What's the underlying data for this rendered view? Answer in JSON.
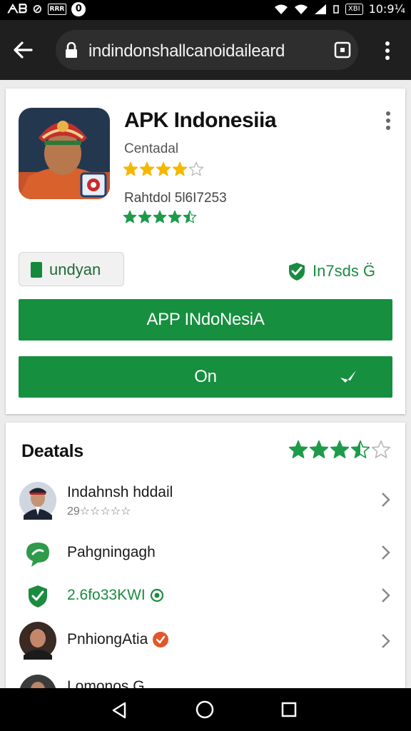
{
  "status_bar": {
    "left_text": "ᗅᗷ",
    "box_label": "RRR",
    "ring_label": "0",
    "battery_label": "XBI",
    "time": "10:9¼"
  },
  "browser": {
    "url": "indindonshallcanoidaileard",
    "icons": [
      "back-arrow-icon",
      "lock-icon",
      "tab-switcher-icon",
      "more-vertical-icon"
    ]
  },
  "app": {
    "title": "APK Indonesiia",
    "publisher": "Centadal",
    "rating_value": 4,
    "rating_line": "Rahtdol 5l6I7253",
    "rating2_value": 4.5,
    "chip_label": "undyan",
    "verified_label": "In7sds G̈",
    "primary_button": "APP INdoNesiA",
    "secondary_button": "On",
    "colors": {
      "brand_green": "#168f3e",
      "star_gold": "#f5b800",
      "star_green": "#1e9b4a"
    }
  },
  "details": {
    "title": "Deatals",
    "rating_value": 3.5,
    "rows": [
      {
        "name": "Indahnsh hddail",
        "sub": "29☆☆☆☆☆",
        "icon": "avatar"
      },
      {
        "name": "Pahgningagh",
        "sub": "",
        "icon": "chat-bubble-icon"
      },
      {
        "name": "2.6fo33KWI",
        "sub": "",
        "icon": "shield-check-icon"
      },
      {
        "name": "PnhiongAtia",
        "sub": "",
        "icon": "avatar"
      },
      {
        "name": "Lomonos G",
        "sub": "",
        "icon": "avatar"
      }
    ]
  },
  "nav_bar": {
    "icons": [
      "nav-back-icon",
      "nav-home-icon",
      "nav-recents-icon"
    ]
  }
}
